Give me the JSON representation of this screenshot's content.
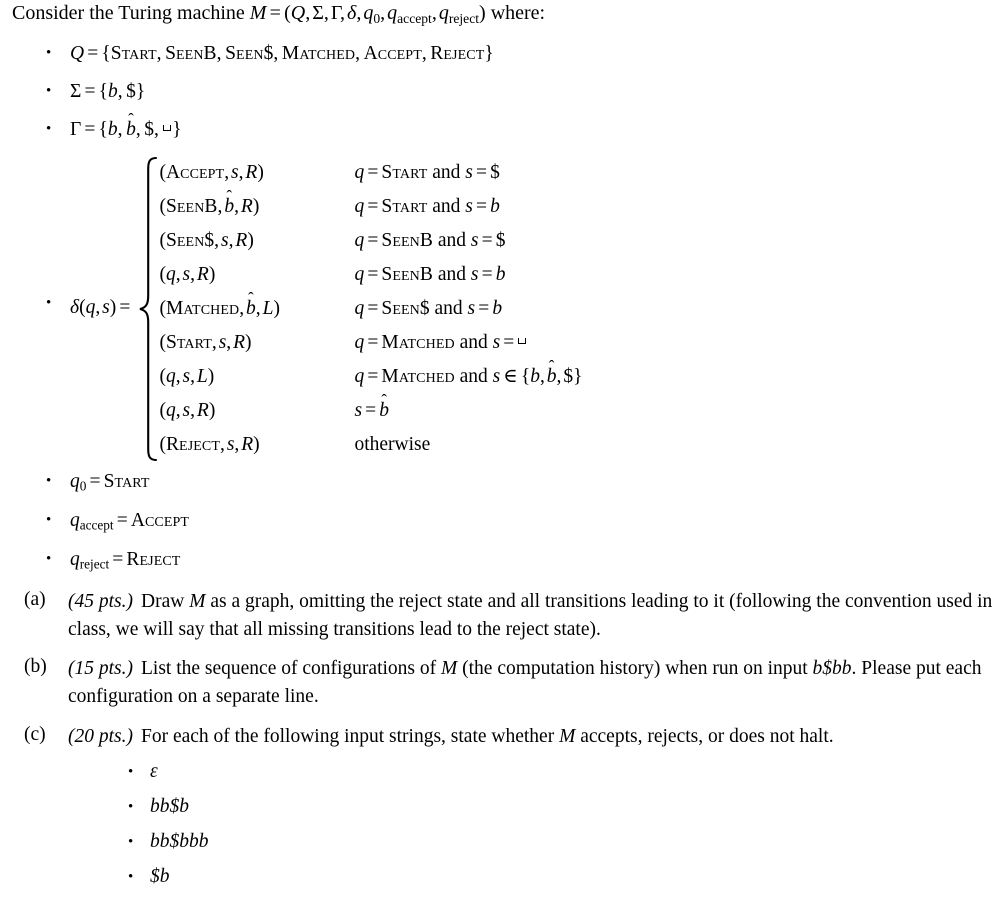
{
  "document": {
    "intro": {
      "lead": "Consider the Turing machine",
      "machine_symbol": "M",
      "equals": "=",
      "tuple": "(Q, Σ, Γ, δ, q₀, q_accept, q_reject)",
      "tuple_items": [
        "Q",
        "Σ",
        "Γ",
        "δ",
        "q",
        "q",
        "q"
      ],
      "tuple_subs": [
        "0",
        "accept",
        "reject"
      ],
      "trailing": "where:"
    },
    "definitions": [
      {
        "name": "states-set",
        "lhs": "Q",
        "rel": "=",
        "rhs_open": "{",
        "rhs_close": "}",
        "states": [
          "Start",
          "SeenB",
          "Seen$",
          "Matched",
          "Accept",
          "Reject"
        ]
      },
      {
        "name": "input-alphabet",
        "lhs": "Σ",
        "rel": "=",
        "rhs_open": "{",
        "rhs_close": "}",
        "symbols": [
          "b",
          "$"
        ]
      },
      {
        "name": "tape-alphabet",
        "lhs": "Γ",
        "rel": "=",
        "rhs_open": "{",
        "rhs_close": "}",
        "symbols": [
          "b",
          "b̂",
          "$",
          "␣"
        ]
      }
    ],
    "delta": {
      "label_delta": "δ",
      "label_args": "(q, s)",
      "label_equals": "=",
      "cases": [
        {
          "action": "(Accept, s, R)",
          "condition": "q = Start and s = $"
        },
        {
          "action": "(SeenB, b̂, R)",
          "condition": "q = Start and s = b"
        },
        {
          "action": "(Seen$, s, R)",
          "condition": "q = SeenB and s = $"
        },
        {
          "action": "(q, s, R)",
          "condition": "q = SeenB and s = b"
        },
        {
          "action": "(Matched, b̂, L)",
          "condition": "q = Seen$ and s = b"
        },
        {
          "action": "(Start, s, R)",
          "condition": "q = Matched and s = ␣"
        },
        {
          "action": "(q, s, L)",
          "condition": "q = Matched and s ∈ {b, b̂, $}"
        },
        {
          "action": "(q, s, R)",
          "condition": "s = b̂"
        },
        {
          "action": "(Reject, s, R)",
          "condition": "otherwise"
        }
      ]
    },
    "special_states": [
      {
        "name": "start-state",
        "lhs": "q",
        "sub": "0",
        "rel": "=",
        "rhs": "Start"
      },
      {
        "name": "accept-state",
        "lhs": "q",
        "sub": "accept",
        "rel": "=",
        "rhs": "Accept"
      },
      {
        "name": "reject-state",
        "lhs": "q",
        "sub": "reject",
        "rel": "=",
        "rhs": "Reject"
      }
    ],
    "parts": [
      {
        "label": "(a)",
        "points": "(45 pts.)",
        "text": "Draw M as a graph, omitting the reject state and all transitions leading to it (following the convention used in class, we will say that all missing transitions lead to the reject state)."
      },
      {
        "label": "(b)",
        "points": "(15 pts.)",
        "text": "List the sequence of configurations of M (the computation history) when run on input b$bb. Please put each configuration on a separate line."
      },
      {
        "label": "(c)",
        "points": "(20 pts.)",
        "text": "For each of the following input strings, state whether M accepts, rejects, or does not halt."
      }
    ],
    "test_strings": [
      "ε",
      "bb$b",
      "bb$bbb",
      "$b"
    ],
    "colors": {
      "background": "#ffffff",
      "text": "#000000"
    }
  }
}
